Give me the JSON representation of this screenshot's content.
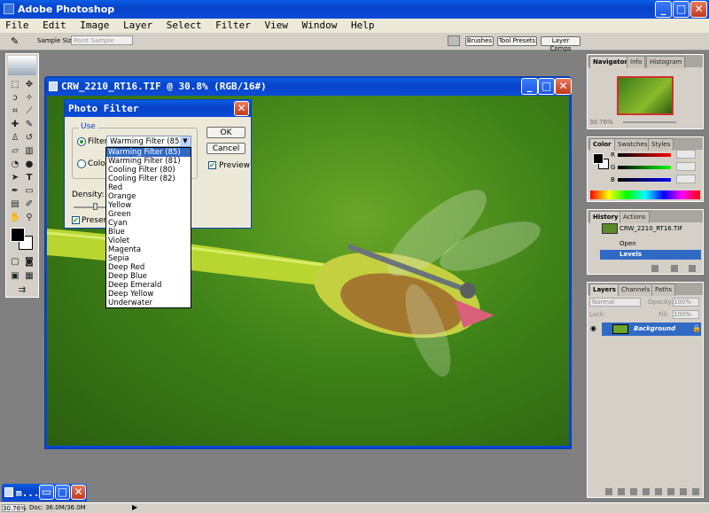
{
  "app": {
    "title": "Adobe Photoshop"
  },
  "menu": [
    "File",
    "Edit",
    "Image",
    "Layer",
    "Select",
    "Filter",
    "View",
    "Window",
    "Help"
  ],
  "options": {
    "sample_size_label": "Sample Size:",
    "sample_size_value": "Point Sample"
  },
  "palette_well": [
    "Brushes",
    "Tool Presets",
    "Layer Comps"
  ],
  "document": {
    "title": "CRW_2210_RT16.TIF @ 30.8% (RGB/16#)"
  },
  "dialog": {
    "title": "Photo Filter",
    "group_label": "Use",
    "filter_label": "Filter:",
    "filter_value": "Warming Filter (85)",
    "color_label": "Color:",
    "ok": "OK",
    "cancel": "Cancel",
    "preview": "Preview",
    "density_label": "Density:",
    "preserve_label": "Preserve",
    "filter_options": [
      "Warming Filter (85)",
      "Warming Filter (81)",
      "Cooling Filter (80)",
      "Cooling Filter (82)",
      "Red",
      "Orange",
      "Yellow",
      "Green",
      "Cyan",
      "Blue",
      "Violet",
      "Magenta",
      "Sepia",
      "Deep Red",
      "Deep Blue",
      "Deep Emerald",
      "Deep Yellow",
      "Underwater"
    ]
  },
  "navigator": {
    "tabs": [
      "Navigator",
      "Info",
      "Histogram"
    ],
    "zoom": "30.76%"
  },
  "color_panel": {
    "tabs": [
      "Color",
      "Swatches",
      "Styles"
    ],
    "channels": [
      "R",
      "G",
      "B"
    ]
  },
  "history": {
    "tabs": [
      "History",
      "Actions"
    ],
    "snapshot": "CRW_2210_RT16.TIF",
    "items": [
      "Open",
      "Levels"
    ]
  },
  "layers": {
    "tabs": [
      "Layers",
      "Channels",
      "Paths"
    ],
    "blend_mode": "Normal",
    "opacity_label": "Opacity:",
    "opacity": "100%",
    "lock_label": "Lock:",
    "fill_label": "Fill:",
    "fill": "100%",
    "layer_name": "Background"
  },
  "status": {
    "zoom": "30.76%",
    "doc": "Doc: 36.0M/36.0M"
  },
  "minimized": {
    "label": "m..."
  }
}
